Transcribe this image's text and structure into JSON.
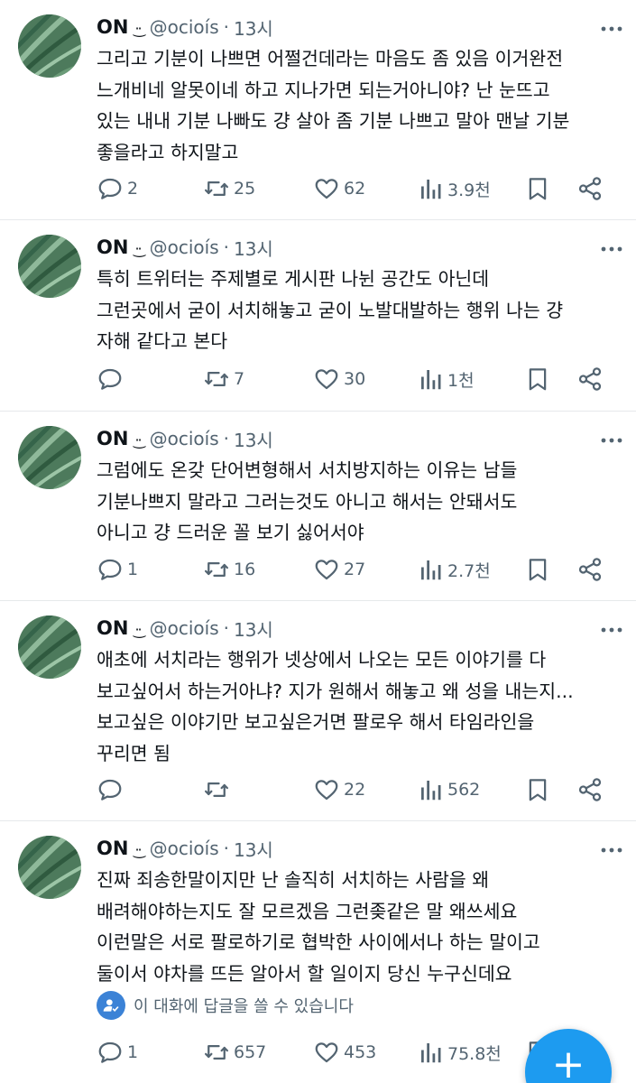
{
  "tweets": [
    {
      "name": "ON",
      "emoticon": "·͜·",
      "handle": "@ocioís",
      "separator": "·",
      "time": "13시",
      "text": "그리고 기분이 나쁘면 어쩔건데라는 마음도 좀 있음 이거완전\n느개비네 알못이네 하고 지나가면 되는거아니야? 난 눈뜨고\n있는 내내 기분 나빠도 걍 살아 좀 기분 나쁘고 말아 맨날 기분\n좋을라고 하지말고",
      "replies": "2",
      "retweets": "25",
      "likes": "62",
      "views": "3.9천"
    },
    {
      "name": "ON",
      "emoticon": "·͜·",
      "handle": "@ocioís",
      "separator": "·",
      "time": "13시",
      "text": "특히 트위터는 주제별로 게시판 나뉜 공간도 아닌데\n그런곳에서 굳이 서치해놓고 굳이 노발대발하는 행위 나는 걍\n자해 같다고 본다",
      "replies": "",
      "retweets": "7",
      "likes": "30",
      "views": "1천"
    },
    {
      "name": "ON",
      "emoticon": "·͜·",
      "handle": "@ocioís",
      "separator": "·",
      "time": "13시",
      "text": "그럼에도 온갖 단어변형해서 서치방지하는 이유는 남들\n기분나쁘지 말라고 그러는것도 아니고 해서는 안돼서도\n아니고 걍 드러운 꼴 보기 싫어서야",
      "replies": "1",
      "retweets": "16",
      "likes": "27",
      "views": "2.7천"
    },
    {
      "name": "ON",
      "emoticon": "·͜·",
      "handle": "@ocioís",
      "separator": "·",
      "time": "13시",
      "text": "애초에 서치라는 행위가 넷상에서 나오는 모든 이야기를 다\n보고싶어서 하는거아냐? 지가 원해서 해놓고 왜 성을 내는지...\n보고싶은 이야기만 보고싶은거면 팔로우 해서 타임라인을\n꾸리면 됨",
      "replies": "",
      "retweets": "",
      "likes": "22",
      "views": "562"
    },
    {
      "name": "ON",
      "emoticon": "·͜·",
      "handle": "@ocioís",
      "separator": "·",
      "time": "13시",
      "text": "진짜 죄송한말이지만 난 솔직히 서치하는 사람을 왜\n배려해야하는지도 잘 모르겠음 그런좆같은 말 왜쓰세요\n이런말은 서로 팔로하기로 협박한 사이에서나 하는 말이고\n둘이서 야차를 뜨든 알아서 할 일이지 당신 누구신데요",
      "replies": "1",
      "retweets": "657",
      "likes": "453",
      "views": "75.8천"
    }
  ],
  "reply_restriction": "이 대화에 답글을 쓸 수 있습니다",
  "fab": {
    "icon": "plus-icon",
    "symbol": "+"
  },
  "colors": {
    "accent": "#1d9bf0",
    "muted": "#536471",
    "text": "#0f1419",
    "divider": "#e6e9eb"
  }
}
